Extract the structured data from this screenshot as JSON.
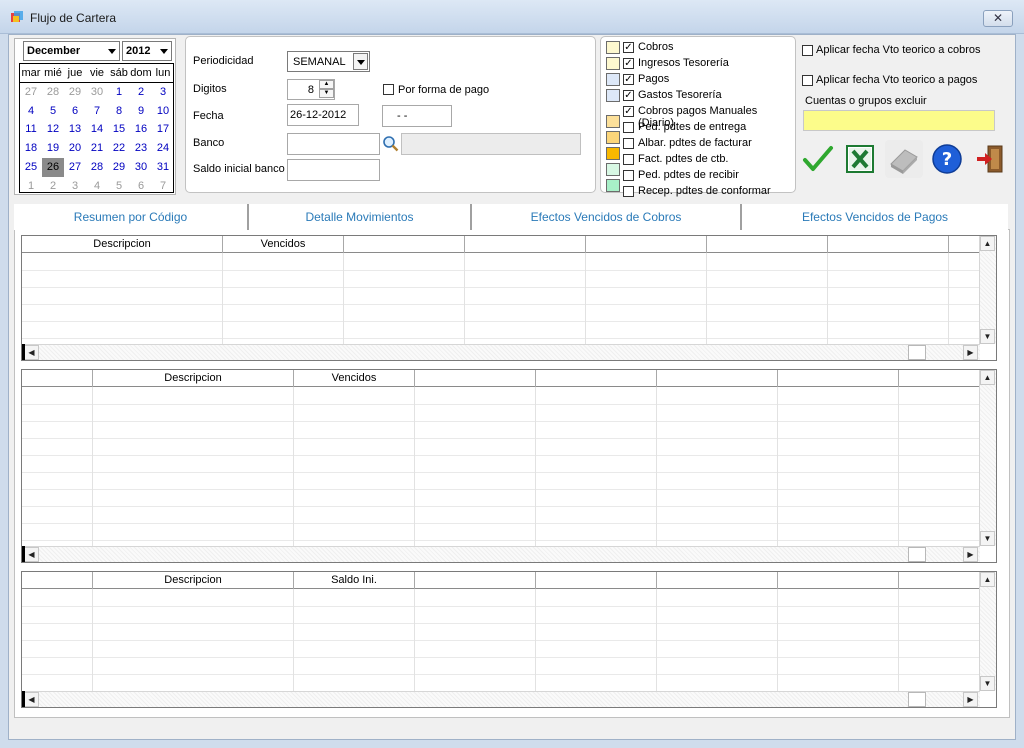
{
  "window": {
    "title": "Flujo de Cartera",
    "close_label": "✕"
  },
  "calendar": {
    "month": "December",
    "year": "2012",
    "day_headers": [
      "mar",
      "mié",
      "jue",
      "vie",
      "sáb",
      "dom",
      "lun"
    ],
    "weeks": [
      [
        "27",
        "28",
        "29",
        "30",
        "1",
        "2",
        "3"
      ],
      [
        "4",
        "5",
        "6",
        "7",
        "8",
        "9",
        "10"
      ],
      [
        "11",
        "12",
        "13",
        "14",
        "15",
        "16",
        "17"
      ],
      [
        "18",
        "19",
        "20",
        "21",
        "22",
        "23",
        "24"
      ],
      [
        "25",
        "26",
        "27",
        "28",
        "29",
        "30",
        "31"
      ],
      [
        "1",
        "2",
        "3",
        "4",
        "5",
        "6",
        "7"
      ]
    ],
    "selected_day": "26"
  },
  "params": {
    "periodicidad_label": "Periodicidad",
    "periodicidad_value": "SEMANAL",
    "digitos_label": "Digitos",
    "digitos_value": "8",
    "por_forma_pago_label": "Por forma de pago",
    "fecha_label": "Fecha",
    "fecha_value": "26-12-2012",
    "fecha2_value": "- -",
    "banco_label": "Banco",
    "banco_value": "",
    "saldo_label": "Saldo inicial banco",
    "saldo_value": ""
  },
  "legend": [
    {
      "label": "Cobros",
      "checked": true,
      "color": "#fdf8cf"
    },
    {
      "label": "Ingresos Tesorería",
      "checked": true,
      "color": "#fdf8cf"
    },
    {
      "label": "Pagos",
      "checked": true,
      "color": "#dde8f8"
    },
    {
      "label": "Gastos Tesorería",
      "checked": true,
      "color": "#dde8f8"
    },
    {
      "label": "Cobros pagos Manuales (Diario)",
      "checked": true,
      "color": "#ffffff"
    },
    {
      "label": "Ped. pdtes de entrega",
      "checked": false,
      "color": "#fce09a"
    },
    {
      "label": "Albar. pdtes de facturar",
      "checked": false,
      "color": "#fcd67a"
    },
    {
      "label": "Fact. pdtes de ctb.",
      "checked": false,
      "color": "#f8b800"
    },
    {
      "label": "Ped. pdtes de recibir",
      "checked": false,
      "color": "#d8f8e4"
    },
    {
      "label": "Recep. pdtes de conformar",
      "checked": false,
      "color": "#a8f0c8"
    }
  ],
  "options": {
    "vto_cobros_label": "Aplicar fecha Vto teorico  a cobros",
    "vto_pagos_label": "Aplicar fecha Vto teorico  a pagos",
    "cuentas_label": "Cuentas o grupos excluir",
    "cuentas_value": ""
  },
  "toolbar": {
    "accept_icon": "check-icon",
    "excel_icon": "excel-icon",
    "eraser_icon": "eraser-icon",
    "help_icon": "help-icon",
    "exit_icon": "exit-icon",
    "accept_color": "#2fa82f",
    "excel_color": "#1d7a32",
    "help_color": "#1f5fd8",
    "exit_color": "#d02020"
  },
  "tabs": [
    "Resumen por Código",
    "Detalle Movimientos",
    "Efectos Vencidos de Cobros",
    "Efectos Vencidos de Pagos"
  ],
  "grids": [
    {
      "headers": [
        "Descripcion",
        "Vencidos",
        "",
        "",
        "",
        "",
        ""
      ]
    },
    {
      "headers": [
        "",
        "Descripcion",
        "Vencidos",
        "",
        "",
        "",
        "",
        ""
      ]
    },
    {
      "headers": [
        "",
        "Descripcion",
        "Saldo Ini.",
        "",
        "",
        "",
        "",
        ""
      ]
    }
  ]
}
